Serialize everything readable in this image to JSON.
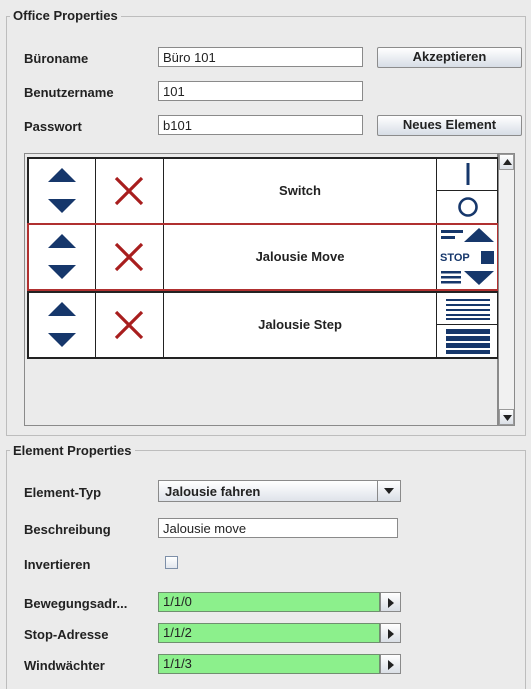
{
  "office": {
    "title": "Office Properties",
    "name_label": "Büroname",
    "name_value": "Büro 101",
    "user_label": "Benutzername",
    "user_value": "101",
    "password_label": "Passwort",
    "password_value": "b101",
    "accept_label": "Akzeptieren",
    "new_element_label": "Neues Element"
  },
  "elements": [
    {
      "name": "Switch",
      "icon": "switch-on-off-icon",
      "selected": false
    },
    {
      "name": "Jalousie Move",
      "icon": "jalousie-move-icon",
      "selected": true
    },
    {
      "name": "Jalousie Step",
      "icon": "jalousie-step-icon",
      "selected": false
    }
  ],
  "stop_text": "STOP",
  "element_props": {
    "title": "Element Properties",
    "type_label": "Element-Typ",
    "type_value": "Jalousie fahren",
    "desc_label": "Beschreibung",
    "desc_value": "Jalousie move",
    "invert_label": "Invertieren",
    "invert_checked": false,
    "move_label": "Bewegungsadr...",
    "move_value": "1/1/0",
    "stop_label": "Stop-Adresse",
    "stop_value": "1/1/2",
    "wind_label": "Windwächter",
    "wind_value": "1/1/3"
  },
  "colors": {
    "arrow": "#16376b",
    "delete_x": "#a81e1e",
    "address_bg": "#8cf08c",
    "selected_border": "#b03030"
  }
}
